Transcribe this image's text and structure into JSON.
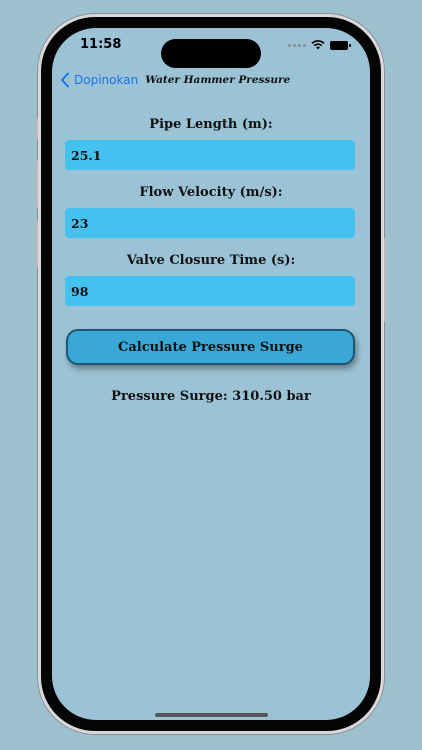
{
  "status_bar": {
    "time": "11:58",
    "icons": [
      "signal-dots-icon",
      "wifi-icon",
      "battery-icon"
    ]
  },
  "nav": {
    "back_label": "Dopinokan",
    "title": "Water Hammer Pressure"
  },
  "form": {
    "pipe_length": {
      "label": "Pipe Length (m):",
      "value": "25.1"
    },
    "flow_velocity": {
      "label": "Flow Velocity (m/s):",
      "value": "23"
    },
    "valve_closure_time": {
      "label": "Valve Closure Time (s):",
      "value": "98"
    }
  },
  "calculate_button": {
    "label": "Calculate Pressure Surge"
  },
  "result": {
    "text": "Pressure Surge: 310.50 bar"
  },
  "colors": {
    "background": "#9dc0cf",
    "screen": "#9cc3d5",
    "input_fill": "#44c1ef",
    "button_fill": "#3aa8d6",
    "link_blue": "#1a73e8"
  }
}
